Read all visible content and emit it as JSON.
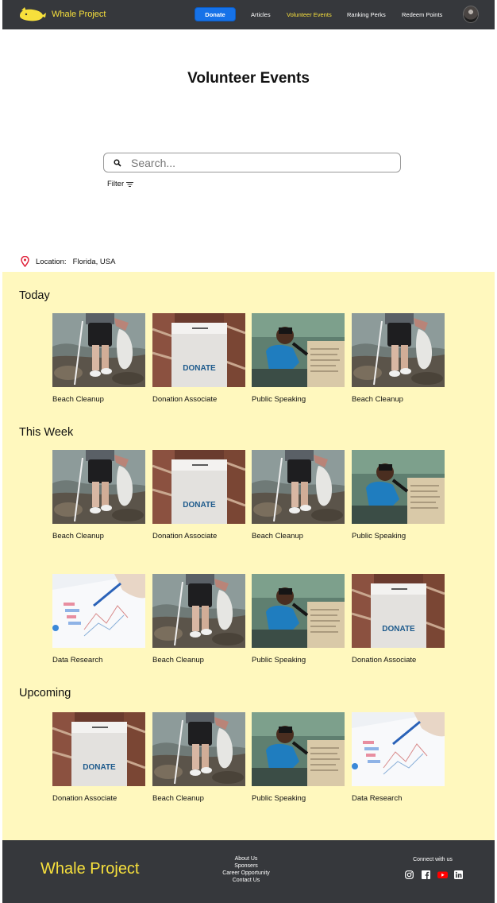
{
  "nav": {
    "brand": "Whale Project",
    "donate_label": "Donate",
    "links": [
      {
        "label": "Articles"
      },
      {
        "label": "Volunteer Events"
      },
      {
        "label": "Ranking Perks"
      },
      {
        "label": "Redeem Points"
      }
    ],
    "active_link": "Volunteer Events"
  },
  "page": {
    "title": "Volunteer Events",
    "search_placeholder": "Search...",
    "filter_label": "Filter",
    "location_label": "Location:",
    "location_value": "Florida, USA"
  },
  "sections": [
    {
      "title": "Today",
      "rows": [
        [
          {
            "label": "Beach Cleanup",
            "image": "beach"
          },
          {
            "label": "Donation Associate",
            "image": "donate"
          },
          {
            "label": "Public Speaking",
            "image": "speaking"
          },
          {
            "label": "Beach Cleanup",
            "image": "beach"
          }
        ]
      ]
    },
    {
      "title": "This Week",
      "rows": [
        [
          {
            "label": "Beach Cleanup",
            "image": "beach"
          },
          {
            "label": "Donation Associate",
            "image": "donate"
          },
          {
            "label": "Beach Cleanup",
            "image": "beach"
          },
          {
            "label": "Public Speaking",
            "image": "speaking"
          }
        ],
        [
          {
            "label": "Data Research",
            "image": "research"
          },
          {
            "label": "Beach Cleanup",
            "image": "beach"
          },
          {
            "label": "Public Speaking",
            "image": "speaking"
          },
          {
            "label": "Donation Associate",
            "image": "donate"
          }
        ]
      ]
    },
    {
      "title": "Upcoming",
      "rows": [
        [
          {
            "label": "Donation Associate",
            "image": "donate"
          },
          {
            "label": "Beach Cleanup",
            "image": "beach"
          },
          {
            "label": "Public Speaking",
            "image": "speaking"
          },
          {
            "label": "Data Research",
            "image": "research"
          }
        ]
      ]
    }
  ],
  "donate_box_text": "DONATE",
  "footer": {
    "brand": "Whale Project",
    "links": [
      {
        "label": "About Us"
      },
      {
        "label": "Sponsers"
      },
      {
        "label": "Career Opportunity"
      },
      {
        "label": "Contact Us"
      }
    ],
    "connect_label": "Connect with us",
    "socials": [
      "instagram-icon",
      "facebook-icon",
      "youtube-icon",
      "linkedin-icon"
    ]
  },
  "colors": {
    "nav_bg": "#36383c",
    "brand_yellow": "#f7e03c",
    "donate_blue": "#1672e8",
    "events_bg": "#fff8be",
    "youtube_red": "#ff0000"
  }
}
